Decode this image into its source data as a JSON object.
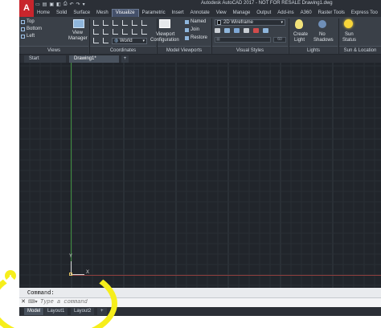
{
  "app": {
    "logo_letter": "A",
    "window_title": "Autodesk AutoCAD 2017 - NOT FOR RESALE   Drawing1.dwg"
  },
  "quick_access": [
    "▭",
    "▤",
    "▣",
    "◧",
    "⎙",
    "↶",
    "↷",
    "▾"
  ],
  "ribbon_tabs": [
    "Home",
    "Solid",
    "Surface",
    "Mesh",
    "Visualize",
    "Parametric",
    "Insert",
    "Annotate",
    "View",
    "Manage",
    "Output",
    "Add-ins",
    "A360",
    "Raster Tools",
    "Express Too"
  ],
  "active_tab": "Visualize",
  "views_panel": {
    "items": [
      "Top",
      "Bottom",
      "Left"
    ],
    "view_manager": [
      "View",
      "Manager"
    ],
    "title": "Views"
  },
  "coordinates_panel": {
    "ucs_value": "World",
    "title": "Coordinates"
  },
  "viewports_panel": {
    "button": [
      "Viewport",
      "Configuration"
    ],
    "named": "Named",
    "join": "Join",
    "restore": "Restore",
    "title": "Model Viewports"
  },
  "visual_styles_panel": {
    "style_value": "2D Wireframe",
    "opacity": "60",
    "title": "Visual Styles"
  },
  "lights_panel": {
    "create_light": [
      "Create",
      "Light"
    ],
    "no_shadows": [
      "No",
      "Shadows"
    ],
    "title": "Lights"
  },
  "sun_panel": {
    "sun_status": [
      "Sun",
      "Status"
    ],
    "title": "Sun & Location"
  },
  "doc_tabs": {
    "start": "Start",
    "drawing": "Drawing1*",
    "add": "+"
  },
  "ucs_icon": {
    "y": "Y",
    "x": "X"
  },
  "command": {
    "label": "Command:",
    "close": "✕",
    "prompt_icon": "⌨▾",
    "placeholder": "Type a command"
  },
  "layout_tabs": {
    "model": "Model",
    "layout1": "Layout1",
    "layout2": "Layout2",
    "add": "+"
  },
  "colors": {
    "canvas": "#21252b",
    "ribbon": "#3a4048",
    "title_bar": "#2b2f36",
    "app_button": "#c8252c",
    "highlight": "#f6ee1b"
  }
}
